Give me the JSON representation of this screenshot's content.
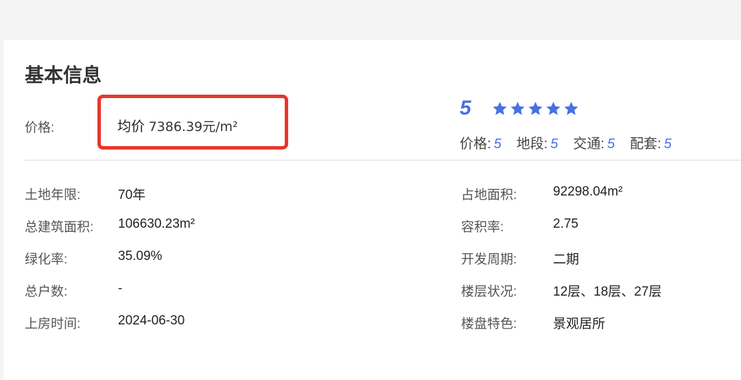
{
  "card": {
    "title": "基本信息"
  },
  "price": {
    "label": "价格:",
    "prefix": "均价",
    "value": "7386.39元/m²"
  },
  "rating": {
    "score": "5",
    "stars": 5,
    "sub": [
      {
        "label": "价格:",
        "value": "5"
      },
      {
        "label": "地段:",
        "value": "5"
      },
      {
        "label": "交通:",
        "value": "5"
      },
      {
        "label": "配套:",
        "value": "5"
      }
    ]
  },
  "left_fields": [
    {
      "label": "土地年限:",
      "value": "70年"
    },
    {
      "label": "总建筑面积:",
      "value": "106630.23m²"
    },
    {
      "label": "绿化率:",
      "value": "35.09%"
    },
    {
      "label": "总户数:",
      "value": "-"
    },
    {
      "label": "上房时间:",
      "value": "2024-06-30"
    }
  ],
  "right_fields": [
    {
      "label": "占地面积:",
      "value": "92298.04m²"
    },
    {
      "label": "容积率:",
      "value": "2.75"
    },
    {
      "label": "开发周期:",
      "value": "二期"
    },
    {
      "label": "楼层状况:",
      "value": "12层、18层、27层"
    },
    {
      "label": "楼盘特色:",
      "value": "景观居所"
    }
  ],
  "colors": {
    "accent": "#4870e2",
    "highlight_border": "#e9362a"
  }
}
